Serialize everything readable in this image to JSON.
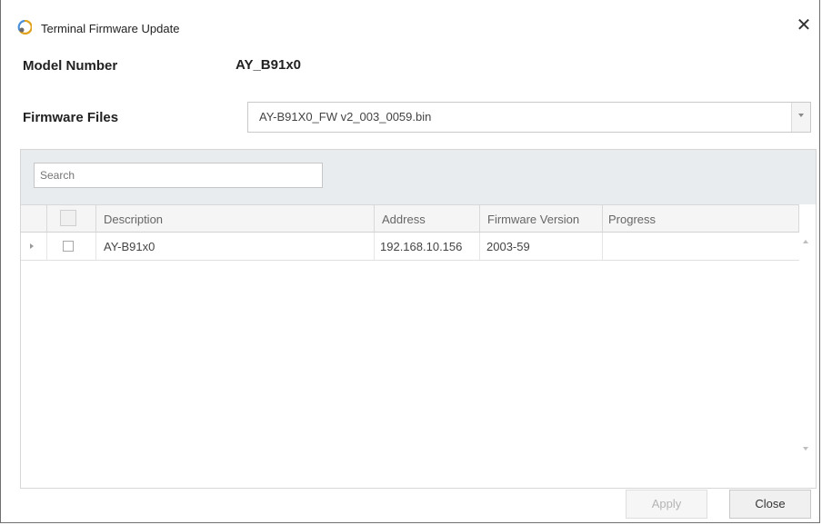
{
  "window": {
    "title": "Terminal Firmware Update",
    "close_glyph": "✕"
  },
  "model": {
    "label": "Model Number",
    "value": "AY_B91x0"
  },
  "firmware": {
    "label": "Firmware Files",
    "selected": "AY-B91X0_FW v2_003_0059.bin"
  },
  "search": {
    "placeholder": "Search"
  },
  "table": {
    "columns": [
      "Description",
      "Address",
      "Firmware Version",
      "Progress"
    ],
    "rows": [
      {
        "description": "AY-B91x0",
        "address": "192.168.10.156",
        "firmware_version": "2003-59",
        "progress": ""
      }
    ]
  },
  "buttons": {
    "apply": "Apply",
    "close": "Close"
  },
  "icons": {
    "app": "firmware-update-icon",
    "window_close": "close-icon",
    "dropdown": "chevron-down-icon",
    "row_indicator": "row-pointer-icon",
    "scroll_up": "scroll-up-icon",
    "scroll_down": "scroll-down-icon"
  },
  "colors": {
    "grid_header_bg": "#f5f5f5",
    "search_panel_bg": "#e9ecef",
    "disabled_text": "#b4b4b4"
  }
}
